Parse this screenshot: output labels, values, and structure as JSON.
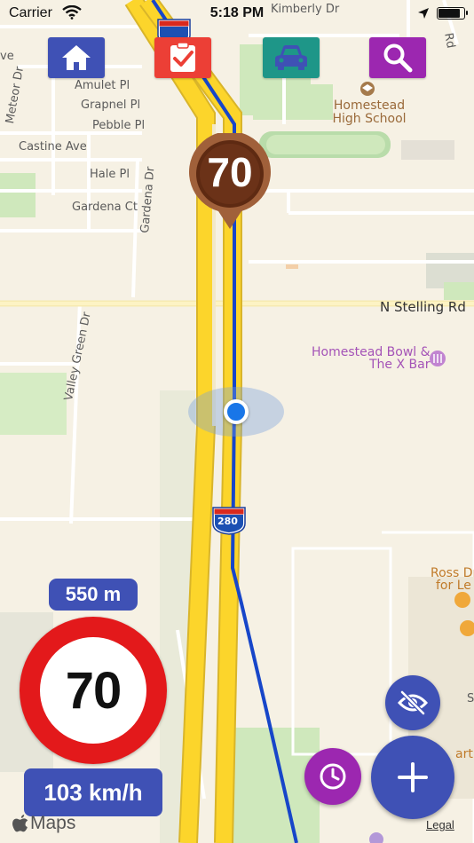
{
  "status_bar": {
    "carrier": "Carrier",
    "time": "5:18 PM",
    "icons": [
      "wifi-icon",
      "location-arrow-icon",
      "battery-icon"
    ]
  },
  "toolbar": {
    "buttons": [
      {
        "name": "home",
        "icon": "home-icon",
        "color": "#3f51b5"
      },
      {
        "name": "checklist",
        "icon": "check-icon",
        "color": "#ec3f36"
      },
      {
        "name": "vehicle",
        "icon": "car-icon",
        "color": "#1e9688"
      },
      {
        "name": "search",
        "icon": "search-icon",
        "color": "#9c27b0"
      }
    ]
  },
  "map": {
    "streets": {
      "kimberly": "Kimberly Dr",
      "meteor": "Meteor Dr",
      "amulet": "Amulet Pl",
      "grapnel": "Grapnel Pl",
      "pebble": "Pebble Pl",
      "castine": "Castine Ave",
      "hale": "Hale Pl",
      "gardena_ct": "Gardena Ct",
      "gardena_dr": "Gardena Dr",
      "stelling": "N Stelling Rd",
      "valley_green": "Valley Green Dr",
      "rd_top": "Rd",
      "ve_left": "ve",
      "s_right": "S"
    },
    "pois": {
      "school": "Homestead High School",
      "bowl_line1": "Homestead Bowl &",
      "bowl_line2": "The X Bar",
      "ross_line1": "Ross Dr",
      "ross_line2": "for Le",
      "art": "art"
    },
    "highway_shield": "280",
    "upcoming_limit": "70"
  },
  "alert": {
    "distance": "550 m",
    "speed_limit": "70",
    "current_speed": "103 km/h"
  },
  "attribution": {
    "maps": "Maps",
    "legal": "Legal"
  },
  "actions": {
    "hide": "eye-off-icon",
    "history": "clock-icon",
    "add": "plus-icon"
  },
  "colors": {
    "primary": "#3f51b5",
    "accent_purple": "#9c27b0",
    "sign_red": "#e3191b",
    "marker_brown": "#6b3218",
    "route_blue": "#1746c9",
    "highway_yellow": "#fcd52b"
  }
}
